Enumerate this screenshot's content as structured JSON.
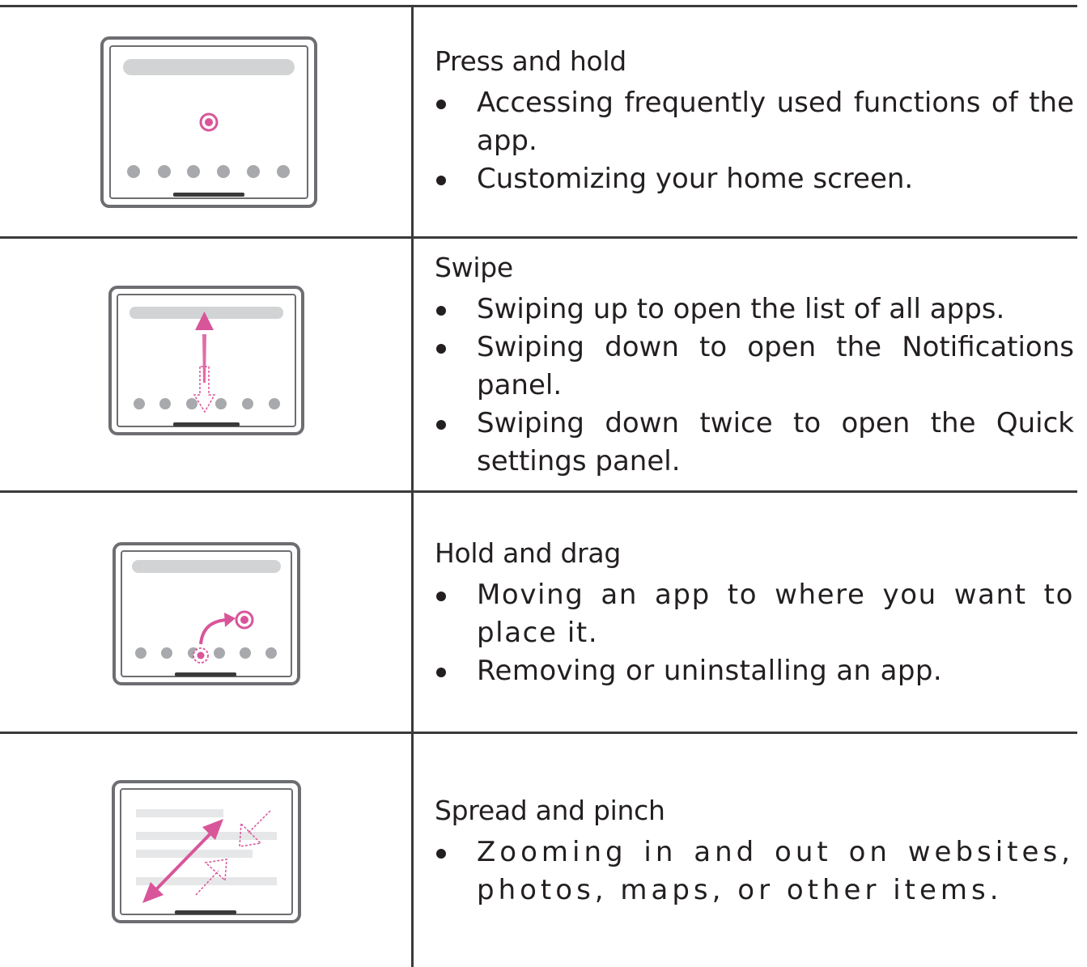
{
  "rows": [
    {
      "title": "Press and hold",
      "bullets": [
        "Accessing frequently used functions of the app.",
        "Customizing your home screen."
      ],
      "icon": "tablet-press-and-hold-icon"
    },
    {
      "title": "Swipe",
      "bullets": [
        "Swiping up to open the list of all apps.",
        "Swiping down to open the Notifications panel.",
        "Swiping down twice to open the Quick settings panel."
      ],
      "icon": "tablet-swipe-icon"
    },
    {
      "title": "Hold and drag",
      "bullets": [
        "Moving an app to where you want to place it.",
        "Removing or uninstalling an app."
      ],
      "icon": "tablet-hold-and-drag-icon"
    },
    {
      "title": "Spread and pinch",
      "bullets": [
        "Zooming in and out on websites, photos, maps, or other items."
      ],
      "icon": "tablet-spread-and-pinch-icon"
    }
  ],
  "colors": {
    "accent": "#d9559a",
    "frame": "#6d6e71",
    "placeholder": "#d1d3d4",
    "dots": "#a7a9ac",
    "rule": "#3a3a3a"
  }
}
